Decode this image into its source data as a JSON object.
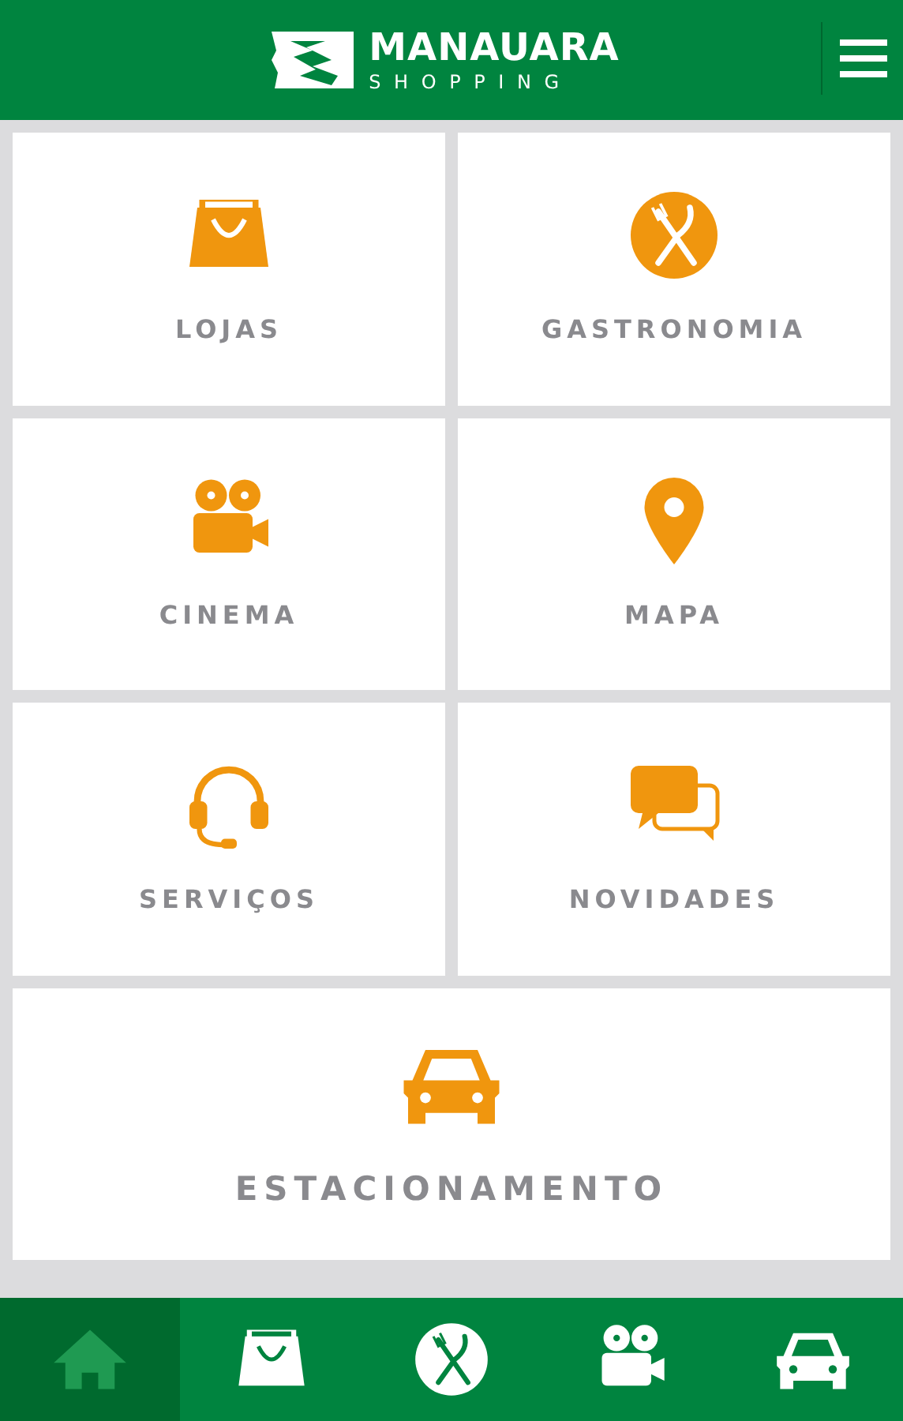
{
  "header": {
    "brand": "MANAUARA",
    "subtitle": "SHOPPING"
  },
  "tiles": [
    {
      "label": "LOJAS",
      "kind": "bag"
    },
    {
      "label": "GASTRONOMIA",
      "kind": "food"
    },
    {
      "label": "CINEMA",
      "kind": "cinema"
    },
    {
      "label": "MAPA",
      "kind": "pin"
    },
    {
      "label": "SERVIÇOS",
      "kind": "headset"
    },
    {
      "label": "NOVIDADES",
      "kind": "chat"
    },
    {
      "label": "ESTACIONAMENTO",
      "kind": "car"
    }
  ],
  "bottom_nav": [
    {
      "kind": "home",
      "selected": true
    },
    {
      "kind": "bag",
      "selected": false
    },
    {
      "kind": "food",
      "selected": false
    },
    {
      "kind": "cinema",
      "selected": false
    },
    {
      "kind": "car",
      "selected": false
    }
  ]
}
